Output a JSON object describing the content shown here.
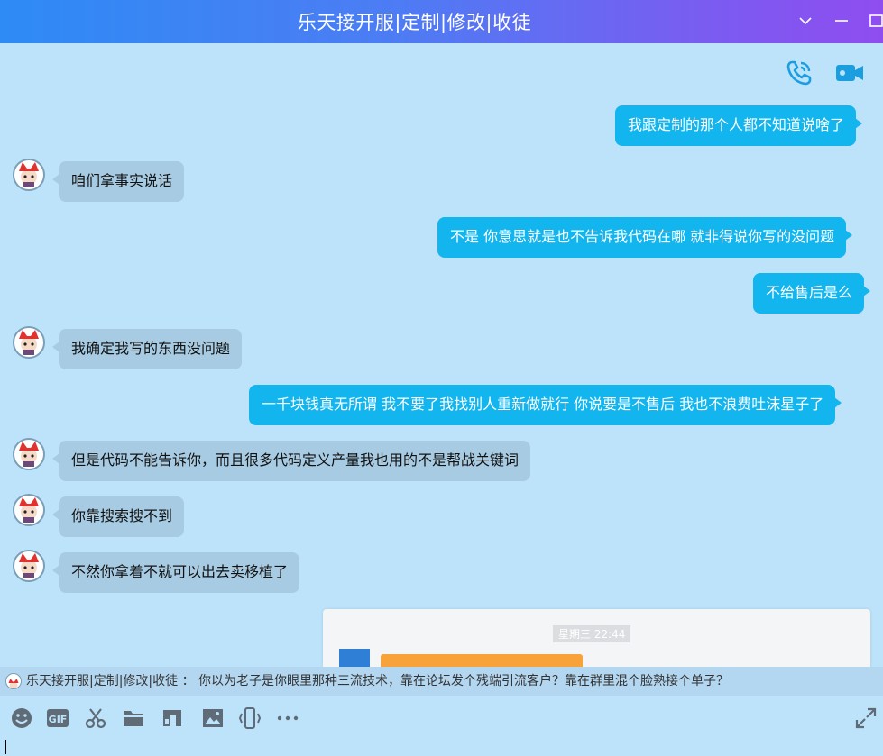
{
  "window": {
    "title": "乐天接开服|定制|修改|收徒"
  },
  "colors": {
    "outgoing_bubble": "#12b5ee",
    "incoming_bubble": "#a7cbe2",
    "background": "#bde3fb",
    "accent_icon": "#1a9ee0"
  },
  "messages": [
    {
      "side": "out",
      "text": "我跟定制的那个人都不知道说啥了"
    },
    {
      "side": "in",
      "text": "咱们拿事实说话"
    },
    {
      "side": "out",
      "text": "不是 你意思就是也不告诉我代码在哪 就非得说你写的没问题"
    },
    {
      "side": "out",
      "text": "不给售后是么"
    },
    {
      "side": "in",
      "text": "我确定我写的东西没问题"
    },
    {
      "side": "out",
      "text": "一千块钱真无所谓 我不要了我找别人重新做就行 你说要是不售后 我也不浪费吐沫星子了"
    },
    {
      "side": "in",
      "text": "但是代码不能告诉你，而且很多代码定义产量我也用的不是帮战关键词"
    },
    {
      "side": "in",
      "text": "你靠搜索搜不到"
    },
    {
      "side": "in",
      "text": "不然你拿着不就可以出去卖移植了"
    }
  ],
  "preview": {
    "timestamp": "星期三 22:44"
  },
  "quote": {
    "text": "乐天接开服|定制|修改|收徒 ： 你以为老子是你眼里那种三流技术，靠在论坛发个残端引流客户？靠在群里混个脸熟接个单子？"
  },
  "toolbar": {
    "icons": [
      "emoji-icon",
      "gif-icon",
      "scissors-icon",
      "folder-icon",
      "music-icon",
      "image-icon",
      "shake-icon",
      "more-icon",
      "expand-icon"
    ]
  }
}
